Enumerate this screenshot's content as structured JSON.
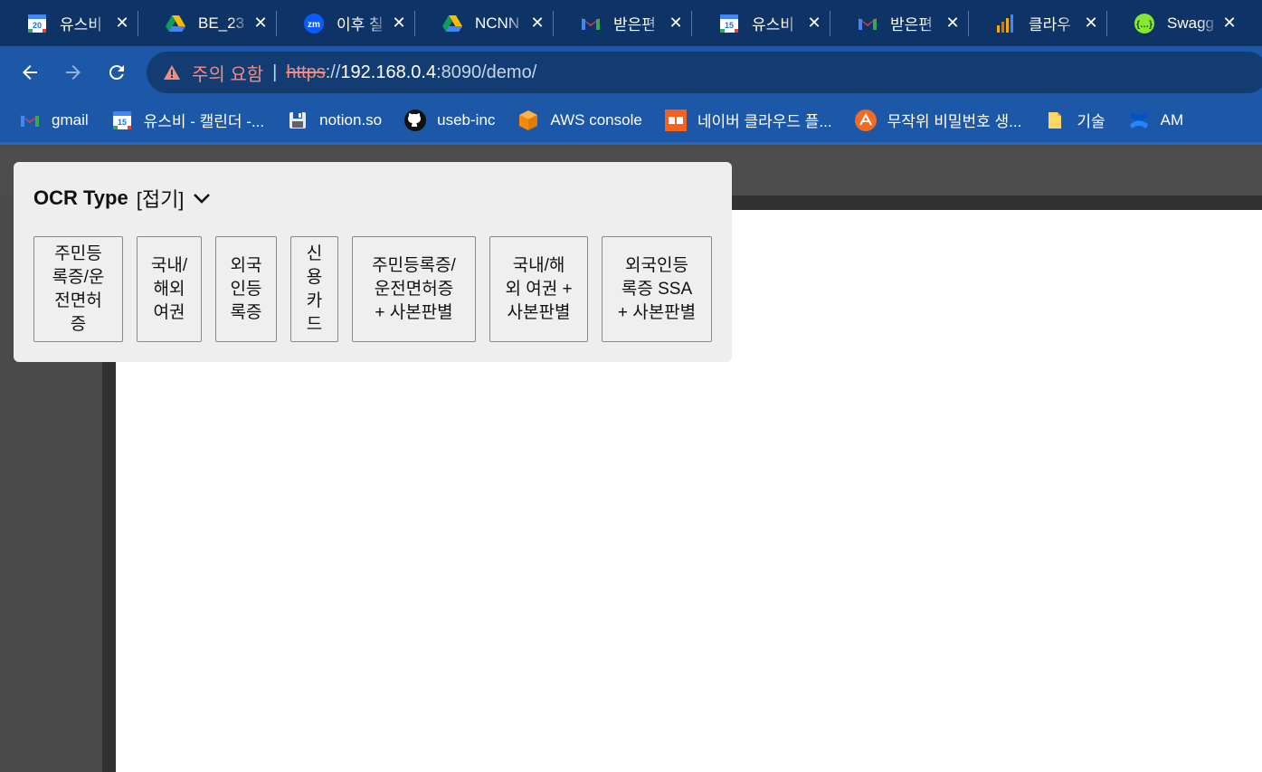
{
  "tabs": [
    {
      "title": "유스비",
      "icon": "google-calendar-20-icon"
    },
    {
      "title": "BE_23",
      "icon": "google-drive-icon"
    },
    {
      "title": "이후 칠",
      "icon": "zoom-icon"
    },
    {
      "title": "NCNN",
      "icon": "google-drive-icon"
    },
    {
      "title": "받은편",
      "icon": "gmail-icon"
    },
    {
      "title": "유스비",
      "icon": "google-calendar-15-icon"
    },
    {
      "title": "받은편",
      "icon": "gmail-icon"
    },
    {
      "title": "클라우",
      "icon": "analytics-chart-icon"
    },
    {
      "title": "Swagg",
      "icon": "swagger-icon"
    }
  ],
  "toolbar": {
    "warning_text": "주의 요함",
    "separator": "|",
    "url_scheme": "https",
    "url_sep": "://",
    "url_host": "192.168.0.4",
    "url_rest": ":8090/demo/"
  },
  "bookmarks": [
    {
      "label": "gmail",
      "icon": "gmail-icon"
    },
    {
      "label": "유스비 - 캘린더 -...",
      "icon": "google-calendar-15-icon"
    },
    {
      "label": "notion.so",
      "icon": "floppy-disk-icon"
    },
    {
      "label": "useb-inc",
      "icon": "github-icon"
    },
    {
      "label": "AWS console",
      "icon": "aws-cube-icon"
    },
    {
      "label": "네이버 클라우드 플...",
      "icon": "naver-cloud-icon"
    },
    {
      "label": "무작위 비밀번호 생...",
      "icon": "password-generator-icon"
    },
    {
      "label": "기술",
      "icon": "folder-icon"
    },
    {
      "label": "AM",
      "icon": "confluence-icon"
    }
  ],
  "ocr": {
    "header_label": "OCR Type",
    "toggle_label": "[접기]",
    "buttons": [
      "주민등\n록증/운\n전면허\n증",
      "국내/\n해외\n여권",
      "외국\n인등\n록증",
      "신\n용\n카\n드",
      "주민등록증/\n운전면허증\n+ 사본판별",
      "국내/해\n외 여권 +\n사본판별",
      "외국인등\n록증 SSA\n+ 사본판별"
    ]
  },
  "colors": {
    "tabstrip": "#0d3367",
    "toolbar": "#1d58a8",
    "omnibox": "#123c72",
    "warning": "#f28b82",
    "panel": "#eeeeee"
  }
}
